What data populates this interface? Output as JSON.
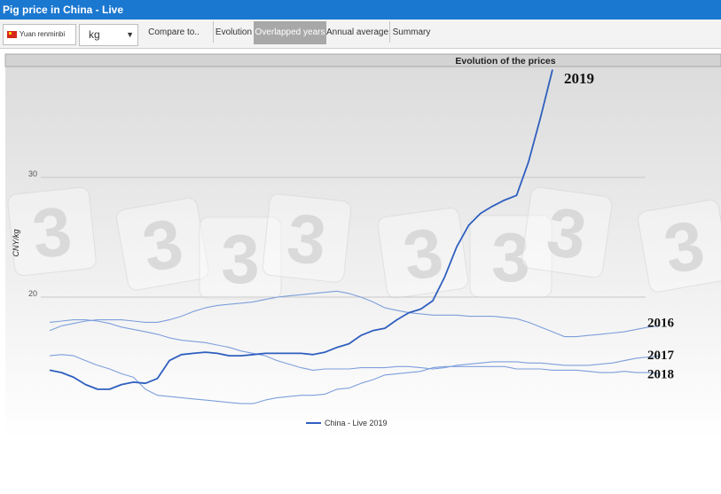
{
  "app": {
    "title": "Pig price in China - Live"
  },
  "toolbar": {
    "currency_label": "Yuan renminbi",
    "unit_value": "kg",
    "compare_label": "Compare to..",
    "tabs": [
      {
        "label": "Evolution",
        "active": false
      },
      {
        "label": "Overlapped years",
        "active": true
      },
      {
        "label": "Annual average",
        "active": false
      },
      {
        "label": "Summary",
        "active": false
      }
    ]
  },
  "colors": {
    "accent": "#1b78d0",
    "series_main": "#2f5fbf",
    "series_faded": "#7d9fdc",
    "active_tab": "#a8a8a8"
  },
  "chart_data": {
    "type": "line",
    "title": "Evolution of the prices",
    "ylabel": "CNY/kg",
    "xlabel": "",
    "ylim": [
      13,
      39.5
    ],
    "yticks": [
      20,
      30
    ],
    "week_range": [
      1,
      52
    ],
    "grid": true,
    "legend": "bottom-center",
    "legend_entry": "China - Live 2019",
    "watermark": "3",
    "series": [
      {
        "name": "2016",
        "label_value": 17.9,
        "x": [
          1,
          2,
          3,
          4,
          5,
          6,
          7,
          8,
          9,
          10,
          11,
          12,
          13,
          14,
          15,
          16,
          17,
          18,
          19,
          20,
          21,
          22,
          23,
          24,
          25,
          26,
          27,
          28,
          29,
          30,
          31,
          32,
          33,
          34,
          35,
          36,
          37,
          38,
          39,
          40,
          41,
          42,
          43,
          44,
          45,
          46,
          47,
          48,
          49,
          50,
          51,
          52
        ],
        "values": [
          17.2,
          17.6,
          17.8,
          18.0,
          18.1,
          18.1,
          18.1,
          18.0,
          17.9,
          17.9,
          18.1,
          18.4,
          18.8,
          19.1,
          19.3,
          19.4,
          19.5,
          19.6,
          19.8,
          20.0,
          20.1,
          20.2,
          20.3,
          20.4,
          20.5,
          20.3,
          20.0,
          19.6,
          19.1,
          18.9,
          18.7,
          18.6,
          18.5,
          18.5,
          18.5,
          18.4,
          18.4,
          18.4,
          18.3,
          18.2,
          17.9,
          17.5,
          17.1,
          16.7,
          16.7,
          16.8,
          16.9,
          17.0,
          17.1,
          17.3,
          17.5,
          17.6
        ]
      },
      {
        "name": "2017",
        "label_value": 15.2,
        "x": [
          1,
          2,
          3,
          4,
          5,
          6,
          7,
          8,
          9,
          10,
          11,
          12,
          13,
          14,
          15,
          16,
          17,
          18,
          19,
          20,
          21,
          22,
          23,
          24,
          25,
          26,
          27,
          28,
          29,
          30,
          31,
          32,
          33,
          34,
          35,
          36,
          37,
          38,
          39,
          40,
          41,
          42,
          43,
          44,
          45,
          46,
          47,
          48,
          49,
          50,
          51,
          52
        ],
        "values": [
          17.9,
          18.0,
          18.1,
          18.1,
          18.0,
          17.8,
          17.5,
          17.3,
          17.1,
          16.9,
          16.6,
          16.4,
          16.3,
          16.2,
          16.0,
          15.8,
          15.5,
          15.3,
          15.1,
          14.7,
          14.4,
          14.1,
          13.9,
          14.0,
          14.0,
          14.0,
          14.1,
          14.1,
          14.1,
          14.2,
          14.2,
          14.1,
          14.0,
          14.1,
          14.3,
          14.4,
          14.5,
          14.6,
          14.6,
          14.6,
          14.5,
          14.5,
          14.4,
          14.3,
          14.3,
          14.3,
          14.4,
          14.5,
          14.7,
          14.9,
          15.0,
          15.1
        ]
      },
      {
        "name": "2018",
        "label_value": 13.6,
        "x": [
          1,
          2,
          3,
          4,
          5,
          6,
          7,
          8,
          9,
          10,
          11,
          12,
          13,
          14,
          15,
          16,
          17,
          18,
          19,
          20,
          21,
          22,
          23,
          24,
          25,
          26,
          27,
          28,
          29,
          30,
          31,
          32,
          33,
          34,
          35,
          36,
          37,
          38,
          39,
          40,
          41,
          42,
          43,
          44,
          45,
          46,
          47,
          48,
          49,
          50,
          51,
          52
        ],
        "values": [
          15.1,
          15.2,
          15.1,
          14.7,
          14.3,
          14.0,
          13.6,
          13.3,
          12.3,
          11.8,
          11.7,
          11.6,
          11.5,
          11.4,
          11.3,
          11.2,
          11.1,
          11.1,
          11.4,
          11.6,
          11.7,
          11.8,
          11.8,
          11.9,
          12.3,
          12.4,
          12.8,
          13.1,
          13.5,
          13.6,
          13.7,
          13.8,
          14.1,
          14.2,
          14.2,
          14.2,
          14.2,
          14.2,
          14.2,
          14.0,
          14.0,
          14.0,
          13.9,
          13.9,
          13.9,
          13.8,
          13.7,
          13.7,
          13.8,
          13.7,
          13.7,
          13.6
        ]
      },
      {
        "name": "2019",
        "label_value": 38.3,
        "x": [
          1,
          2,
          3,
          4,
          5,
          6,
          7,
          8,
          9,
          10,
          11,
          12,
          13,
          14,
          15,
          16,
          17,
          18,
          19,
          20,
          21,
          22,
          23,
          24,
          25,
          26,
          27,
          28,
          29,
          30,
          31,
          32,
          33,
          34,
          35,
          36,
          37,
          38,
          39,
          40,
          41,
          42,
          43
        ],
        "values": [
          13.9,
          13.7,
          13.3,
          12.7,
          12.3,
          12.3,
          12.7,
          12.9,
          12.8,
          13.2,
          14.7,
          15.2,
          15.3,
          15.4,
          15.3,
          15.1,
          15.1,
          15.2,
          15.3,
          15.3,
          15.3,
          15.3,
          15.2,
          15.4,
          15.8,
          16.1,
          16.8,
          17.2,
          17.4,
          18.1,
          18.7,
          19.0,
          19.7,
          21.7,
          24.2,
          26.0,
          27.0,
          27.6,
          28.1,
          28.5,
          31.3,
          35.0,
          39.0
        ]
      }
    ]
  }
}
